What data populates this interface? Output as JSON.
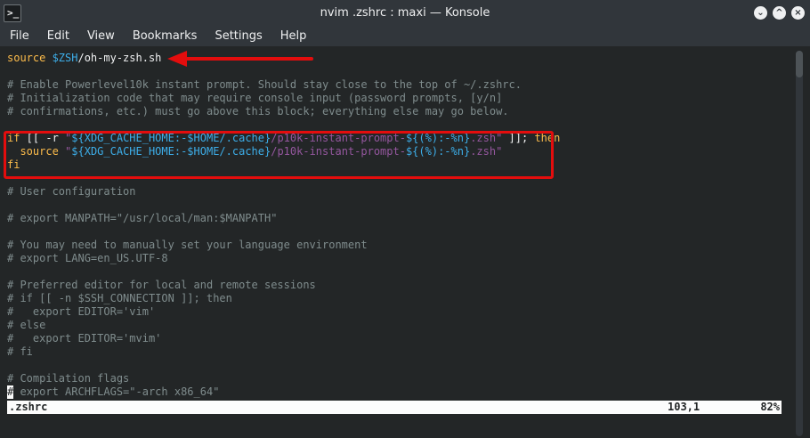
{
  "window": {
    "title": "nvim .zshrc : maxi — Konsole",
    "app_icon_glyph": ">_",
    "min_glyph": "⌄",
    "max_glyph": "^",
    "close_glyph": "×"
  },
  "menu": [
    "File",
    "Edit",
    "View",
    "Bookmarks",
    "Settings",
    "Help"
  ],
  "editor": {
    "lines": [
      [
        {
          "t": "source ",
          "c": "c-kw"
        },
        {
          "t": "$ZSH",
          "c": "c-var"
        },
        {
          "t": "/oh-my-zsh.sh",
          "c": "c-text"
        }
      ],
      [],
      [
        {
          "t": "# Enable Powerlevel10k instant prompt. Should stay close to the top of ~/.zshrc.",
          "c": "c-comment"
        }
      ],
      [
        {
          "t": "# Initialization code that may require console input (password prompts, [y/n]",
          "c": "c-comment"
        }
      ],
      [
        {
          "t": "# confirmations, etc.) must go above this block; everything else may go below.",
          "c": "c-comment"
        }
      ],
      [],
      [
        {
          "t": "if",
          "c": "c-kw"
        },
        {
          "t": " [[ -r ",
          "c": "c-text"
        },
        {
          "t": "\"",
          "c": "c-str"
        },
        {
          "t": "${XDG_CACHE_HOME:-$HOME/.cache}",
          "c": "c-var"
        },
        {
          "t": "/p10k-instant-prompt-",
          "c": "c-str"
        },
        {
          "t": "${(%):-%n}",
          "c": "c-var"
        },
        {
          "t": ".zsh\"",
          "c": "c-str"
        },
        {
          "t": " ]]; ",
          "c": "c-text"
        },
        {
          "t": "then",
          "c": "c-kw"
        }
      ],
      [
        {
          "t": "  source ",
          "c": "c-kw"
        },
        {
          "t": "\"",
          "c": "c-str"
        },
        {
          "t": "${XDG_CACHE_HOME:-$HOME/.cache}",
          "c": "c-var"
        },
        {
          "t": "/p10k-instant-prompt-",
          "c": "c-str"
        },
        {
          "t": "${(%):-%n}",
          "c": "c-var"
        },
        {
          "t": ".zsh\"",
          "c": "c-str"
        }
      ],
      [
        {
          "t": "fi",
          "c": "c-kw"
        }
      ],
      [],
      [
        {
          "t": "# User configuration",
          "c": "c-comment"
        }
      ],
      [],
      [
        {
          "t": "# export MANPATH=\"/usr/local/man:$MANPATH\"",
          "c": "c-comment"
        }
      ],
      [],
      [
        {
          "t": "# You may need to manually set your language environment",
          "c": "c-comment"
        }
      ],
      [
        {
          "t": "# export LANG=en_US.UTF-8",
          "c": "c-comment"
        }
      ],
      [],
      [
        {
          "t": "# Preferred editor for local and remote sessions",
          "c": "c-comment"
        }
      ],
      [
        {
          "t": "# if [[ -n $SSH_CONNECTION ]]; then",
          "c": "c-comment"
        }
      ],
      [
        {
          "t": "#   export EDITOR='vim'",
          "c": "c-comment"
        }
      ],
      [
        {
          "t": "# else",
          "c": "c-comment"
        }
      ],
      [
        {
          "t": "#   export EDITOR='mvim'",
          "c": "c-comment"
        }
      ],
      [
        {
          "t": "# fi",
          "c": "c-comment"
        }
      ],
      [],
      [
        {
          "t": "# Compilation flags",
          "c": "c-comment"
        }
      ],
      [
        {
          "t": "# export ARCHFLAGS=\"-arch x86_64\"",
          "c": "c-comment"
        }
      ]
    ],
    "cursor_line": 25
  },
  "status": {
    "file": ".zshrc",
    "position": "103,1",
    "percent": "82%"
  },
  "scroll": {
    "position_fraction": 0.0,
    "visible_fraction": 0.07
  },
  "colors": {
    "annotation": "#e30d0d",
    "background": "#232627",
    "keyword": "#fdbc4b",
    "comment": "#7f8c8d",
    "variable": "#3daee9",
    "string": "#95579f"
  }
}
